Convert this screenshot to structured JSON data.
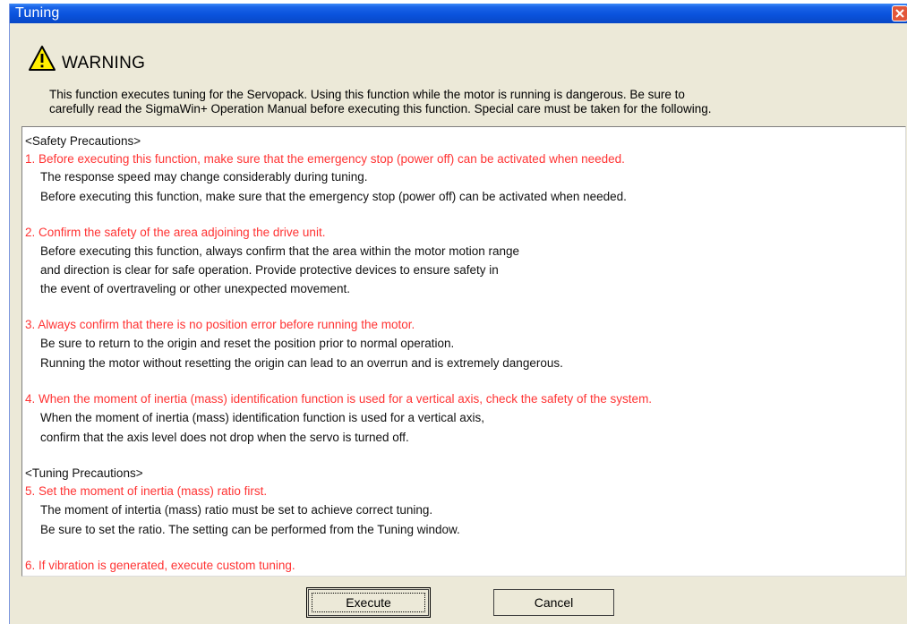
{
  "window": {
    "title": "Tuning"
  },
  "header": {
    "warning_title": "WARNING",
    "intro_line1": "This function executes tuning for the Servopack. Using this function while the motor is running is dangerous. Be sure to",
    "intro_line2": "carefully read the SigmaWin+ Operation Manual before executing this function. Special care must be taken for the following."
  },
  "precautions": [
    {
      "text": "<Safety Precautions>",
      "style": "heading"
    },
    {
      "text": "1. Before executing this function, make sure that the emergency stop (power off) can be activated when needed.",
      "style": "red"
    },
    {
      "text": "The response speed may change considerably during tuning.",
      "style": "body"
    },
    {
      "text": "Before executing this function, make sure that the emergency stop (power off) can be activated when needed.",
      "style": "body"
    },
    {
      "text": "2. Confirm the safety of the area adjoining the drive unit.",
      "style": "red"
    },
    {
      "text": "Before executing this function, always confirm that the area within the motor motion range",
      "style": "body"
    },
    {
      "text": "and direction is clear for safe operation. Provide protective devices to ensure safety in",
      "style": "body"
    },
    {
      "text": "the event of overtraveling or other unexpected movement.",
      "style": "body"
    },
    {
      "text": "3. Always confirm that there is no position error before running the motor.",
      "style": "red"
    },
    {
      "text": "Be sure to return to the origin and reset the position prior to normal operation.",
      "style": "body"
    },
    {
      "text": "Running the motor without resetting the origin can lead to an overrun and is extremely dangerous.",
      "style": "body"
    },
    {
      "text": "4. When the moment of inertia (mass) identification function is used for a vertical axis, check the safety of the system.",
      "style": "red"
    },
    {
      "text": "When the moment of inertia (mass) identification function is used for a vertical axis,",
      "style": "body"
    },
    {
      "text": "confirm that the axis level does not drop when the servo is turned off.",
      "style": "body"
    },
    {
      "text": "<Tuning Precautions>",
      "style": "heading"
    },
    {
      "text": "5. Set the moment of inertia (mass) ratio first.",
      "style": "red"
    },
    {
      "text": "The moment of intertia (mass) ratio must be set to achieve correct tuning.",
      "style": "body"
    },
    {
      "text": "Be sure to set the ratio. The setting can be performed from the Tuning window.",
      "style": "body"
    },
    {
      "text": "6. If vibration is generated, execute custom tuning.",
      "style": "red"
    }
  ],
  "buttons": {
    "execute": "Execute",
    "cancel": "Cancel"
  },
  "colors": {
    "titlebar": "#0a53dd",
    "red_text": "#ff3333",
    "dialog_bg": "#ece9d8",
    "warning_yellow": "#ffee00"
  },
  "icons": {
    "title_close": "close-icon",
    "warning": "warning-icon"
  }
}
